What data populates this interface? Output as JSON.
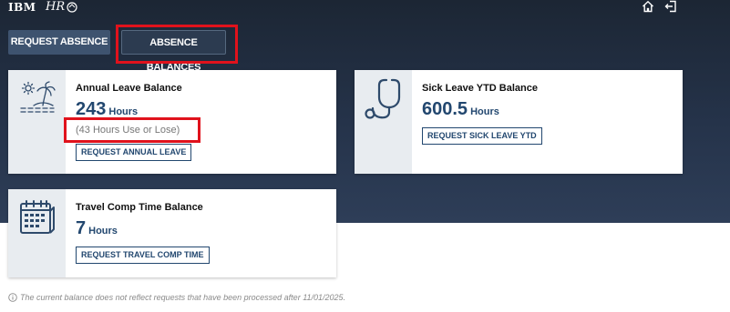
{
  "header": {
    "logo_text": "IBM",
    "app_logo_text": "HR",
    "icons": [
      "home-icon",
      "logout-icon"
    ]
  },
  "tabs": [
    {
      "label": "REQUEST ABSENCE",
      "active": false
    },
    {
      "label": "ABSENCE BALANCES",
      "active": true
    }
  ],
  "cards": {
    "annual": {
      "icon": "beach-icon",
      "title": "Annual Leave Balance",
      "value": "243",
      "unit": "Hours",
      "note": "(43 Hours Use or Lose)",
      "button": "REQUEST ANNUAL LEAVE"
    },
    "sick": {
      "icon": "stethoscope-icon",
      "title": "Sick Leave YTD Balance",
      "value": "600.5",
      "unit": "Hours",
      "button": "REQUEST SICK LEAVE YTD"
    },
    "travel": {
      "icon": "calendar-icon",
      "title": "Travel Comp Time Balance",
      "value": "7",
      "unit": "Hours",
      "button": "REQUEST TRAVEL COMP TIME"
    }
  },
  "footer": {
    "icon": "info-icon",
    "note": "The current balance does not reflect requests that have been processed after 11/01/2025."
  },
  "colors": {
    "accent": "#22476f",
    "highlight": "#e0121c",
    "header_bg": "#1c2634"
  }
}
